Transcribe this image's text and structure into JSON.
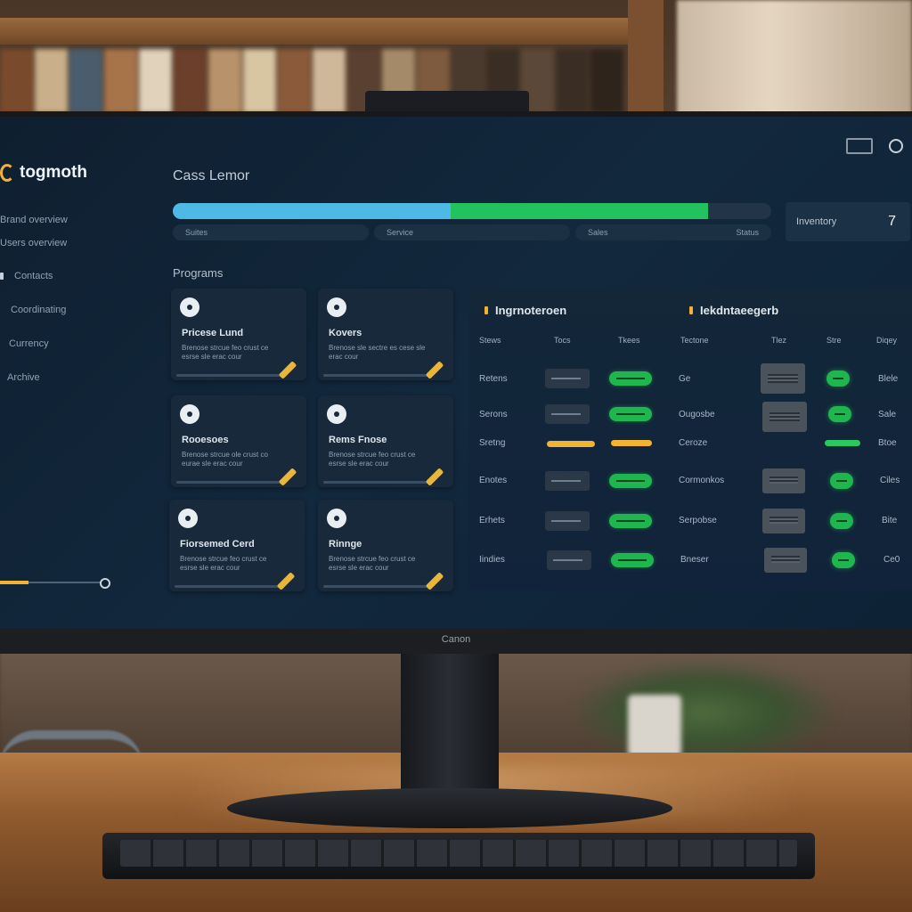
{
  "app": {
    "name": "togmoth"
  },
  "sidebar": {
    "items": [
      {
        "label": "Brand overview"
      },
      {
        "label": "Users overview"
      },
      {
        "label": "Contacts"
      },
      {
        "label": "Coordinating"
      },
      {
        "label": "Currency"
      },
      {
        "label": "Archive"
      }
    ]
  },
  "header": {
    "title": "Cass Lemor"
  },
  "progress": {
    "segment_a": 0.465,
    "segment_b": 0.43,
    "colors": {
      "a": "#4fb9e6",
      "b": "#22c35e"
    },
    "pills": [
      {
        "left": "Suites",
        "right": ""
      },
      {
        "left": "Service",
        "right": ""
      },
      {
        "left": "Sales",
        "right": "Status"
      }
    ]
  },
  "stat": {
    "label": "Inventory",
    "value": "7"
  },
  "section": {
    "label": "Programs"
  },
  "cards": [
    {
      "title": "Pricese Lund",
      "sub": "Brenose strcue feo crust ce esrse sle erac cour"
    },
    {
      "title": "Kovers",
      "sub": "Brenose sle sectre es cese sle erac cour"
    },
    {
      "title": "Rooesoes",
      "sub": "Brenose strcue ole crust co eurae sle erac cour"
    },
    {
      "title": "Rems Fnose",
      "sub": "Brenose strcue feo crust ce esrse sle erac cour"
    },
    {
      "title": "Fiorsemed Cerd",
      "sub": "Brenose strcue feo crust ce esrse sle erac cour"
    },
    {
      "title": "Rinnge",
      "sub": "Brenose strcue feo crust ce esrse sle erac cour"
    }
  ],
  "table": {
    "title_left": "Ingrnoteroen",
    "title_right": "Iekdntaeegerb",
    "columns": [
      "Stews",
      "Tocs",
      "Tkees",
      "Tectone",
      "Tlez",
      "Stre",
      "Diqey"
    ],
    "rows": [
      {
        "name": "Retens",
        "detail": "Ge",
        "value": "Blele"
      },
      {
        "name": "Serons",
        "detail": "Ougosbe",
        "value": "Sale"
      },
      {
        "name": "Sretng",
        "detail": "Ceroze",
        "value": "Btoe"
      },
      {
        "name": "Enotes",
        "detail": "Cormonkos",
        "value": "Ciles"
      },
      {
        "name": "Erhets",
        "detail": "Serpobse",
        "value": "Bite"
      },
      {
        "name": "Iindies",
        "detail": "Bneser",
        "value": "Ce0"
      }
    ]
  },
  "monitor": {
    "brand": "Canon"
  }
}
